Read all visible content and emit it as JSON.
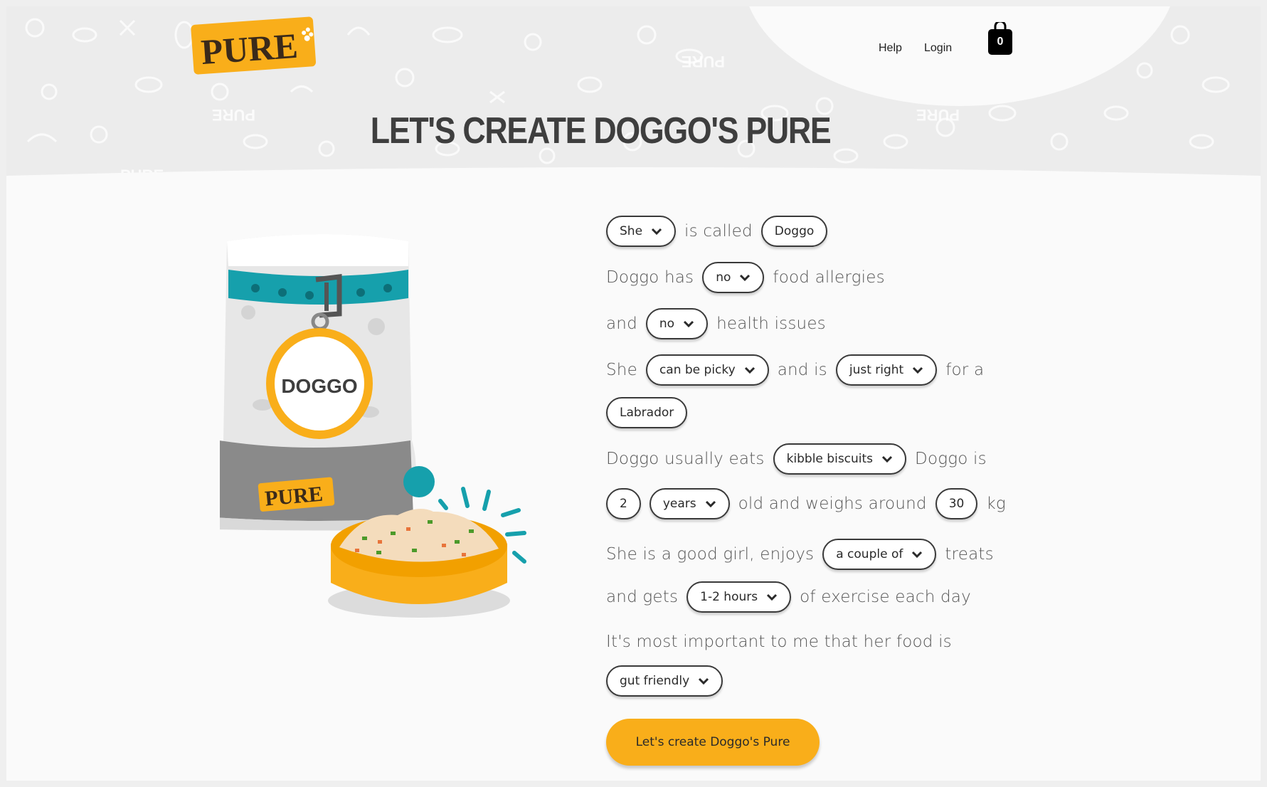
{
  "header": {
    "logo_text": "PURE",
    "nav": {
      "help": "Help",
      "login": "Login"
    },
    "cart_count": "0",
    "pattern_word": "PURE"
  },
  "page_title": "LET'S CREATE DOGGO'S PURE",
  "illustration": {
    "tag_name": "DOGGO",
    "bag_label": "PURE"
  },
  "form": {
    "row1": {
      "pronoun": "She",
      "text1": "is called",
      "name": "Doggo"
    },
    "row2": {
      "text1": "Doggo has",
      "allergies": "no",
      "text2": "food allergies"
    },
    "row3": {
      "text1": "and",
      "health": "no",
      "text2": "health issues"
    },
    "row4": {
      "text1": "She",
      "picky": "can be picky",
      "text2": "and is",
      "size": "just right",
      "text3": "for a"
    },
    "row5": {
      "breed": "Labrador"
    },
    "row6": {
      "text1": "Doggo usually eats",
      "food": "kibble biscuits",
      "text2": "Doggo is"
    },
    "row7": {
      "age": "2",
      "age_unit": "years",
      "text1": "old and weighs around",
      "weight": "30",
      "weight_unit": "kg"
    },
    "row8": {
      "text1": "She is a good girl, enjoys",
      "treats": "a couple of",
      "text2": "treats"
    },
    "row9": {
      "text1": "and gets",
      "exercise": "1-2 hours",
      "text2": "of exercise each day"
    },
    "row10": {
      "text1": "It's most important to me that her food is"
    },
    "row11": {
      "priority": "gut friendly"
    }
  },
  "cta_label": "Let's create Doggo's Pure",
  "colors": {
    "accent_orange": "#f9ae1a",
    "teal": "#16a0ac",
    "dark_text": "#3e3e3e",
    "bag_grey": "#8a8a8a"
  }
}
